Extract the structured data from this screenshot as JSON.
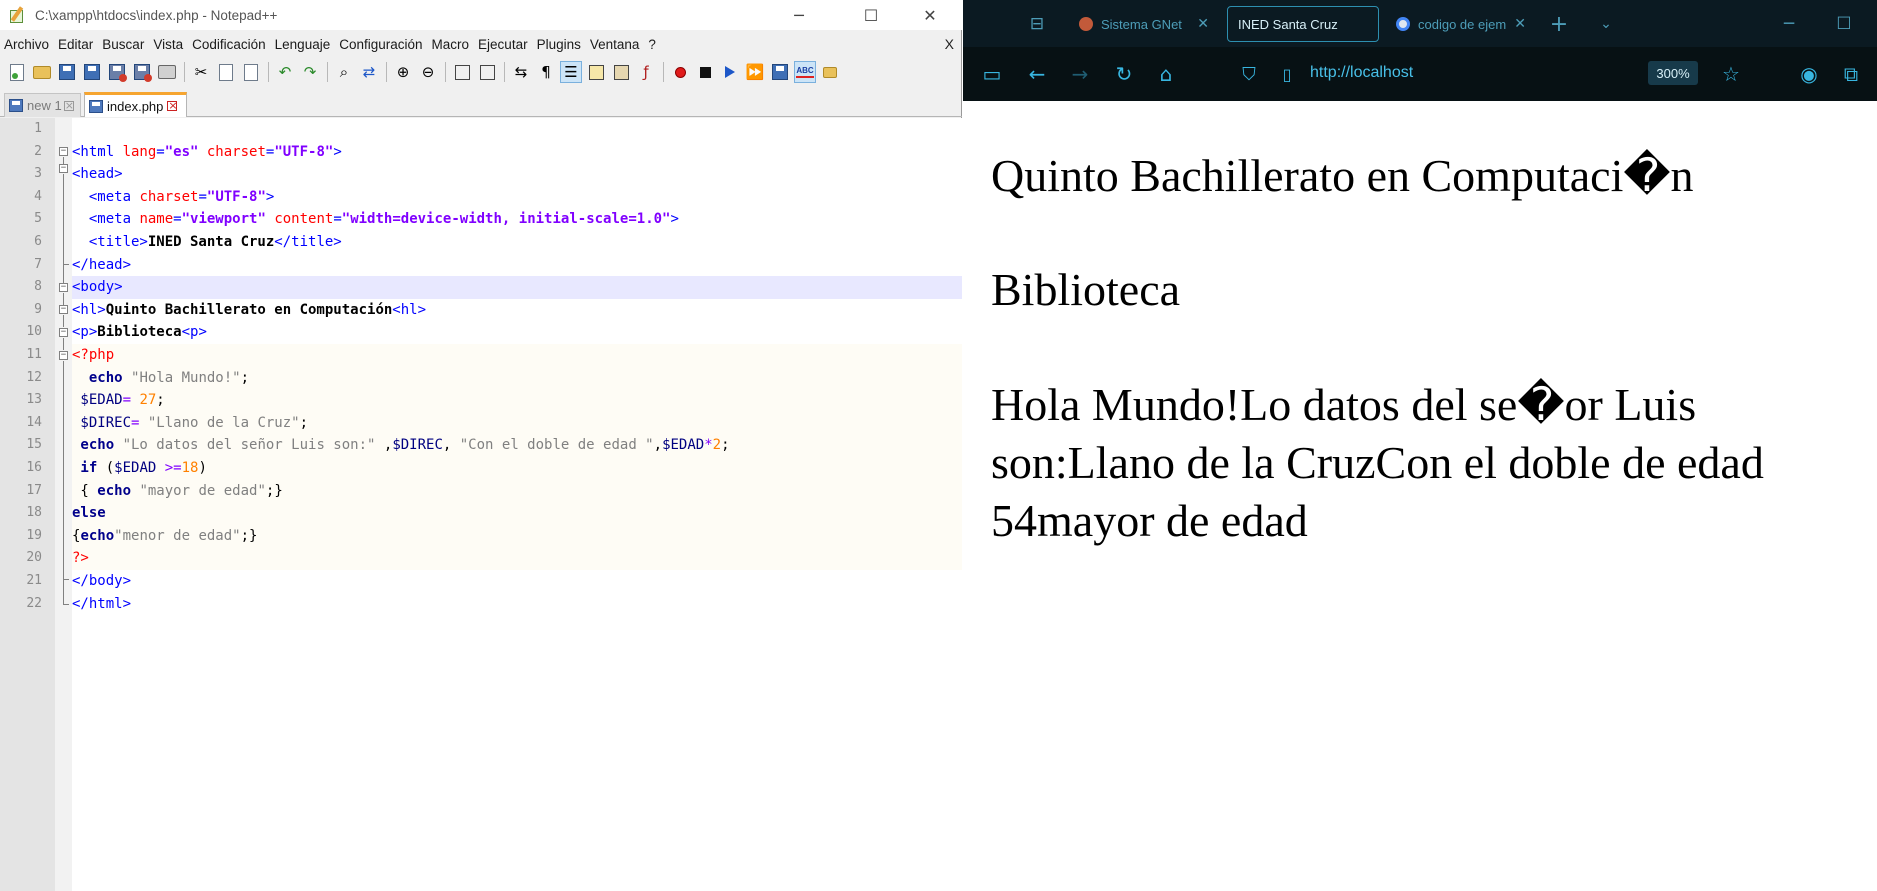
{
  "notepad": {
    "title": "C:\\xampp\\htdocs\\index.php - Notepad++",
    "menu": [
      "Archivo",
      "Editar",
      "Buscar",
      "Vista",
      "Codificación",
      "Lenguaje",
      "Configuración",
      "Macro",
      "Ejecutar",
      "Plugins",
      "Ventana",
      "?"
    ],
    "menu_close": "X",
    "tabs": [
      {
        "label": "new 1"
      },
      {
        "label": "index.php"
      }
    ],
    "line_numbers": [
      "1",
      "2",
      "3",
      "4",
      "5",
      "6",
      "7",
      "8",
      "9",
      "10",
      "11",
      "12",
      "13",
      "14",
      "15",
      "16",
      "17",
      "18",
      "19",
      "20",
      "21",
      "22"
    ],
    "code": {
      "l2": {
        "a": "<html ",
        "b": "lang",
        "c": "=",
        "d": "\"es\"",
        "e": " charset",
        "f": "=",
        "g": "\"UTF-8\"",
        "h": ">"
      },
      "l3": {
        "a": "<head>"
      },
      "l4": {
        "a": "  <meta ",
        "b": "charset",
        "c": "=",
        "d": "\"UTF-8\"",
        "e": ">"
      },
      "l5": {
        "a": "  <meta ",
        "b": "name",
        "c": "=",
        "d": "\"viewport\"",
        "e": " content",
        "f": "=",
        "g": "\"width=device-width, initial-scale=1.0\"",
        "h": ">"
      },
      "l6": {
        "a": "  <title>",
        "b": "INED Santa Cruz",
        "c": "</title>"
      },
      "l7": {
        "a": "</head>"
      },
      "l8": {
        "a": "<body>"
      },
      "l9": {
        "a": "<hl>",
        "b": "Quinto Bachillerato en Computación",
        "c": "<hl>"
      },
      "l10": {
        "a": "<p>",
        "b": "Biblioteca",
        "c": "<p>"
      },
      "l11": {
        "a": "<?php"
      },
      "l12": {
        "a": "  echo ",
        "b": "\"Hola Mundo!\"",
        "c": ";"
      },
      "l13": {
        "a": " $EDAD",
        "b": "= ",
        "c": "27",
        "d": ";"
      },
      "l14": {
        "a": " $DIREC",
        "b": "= ",
        "c": "\"Llano de la Cruz\"",
        "d": ";"
      },
      "l15": {
        "a": " echo ",
        "b": "\"Lo datos del señor Luis son:\"",
        "c": " ,",
        "d": "$DIREC",
        "e": ", ",
        "f": "\"Con el doble de edad \"",
        "g": ",",
        "h": "$EDAD",
        "i": "*",
        "j": "2",
        "k": ";"
      },
      "l16": {
        "a": " if ",
        "b": "(",
        "c": "$EDAD ",
        "d": ">=",
        "e": "18",
        "f": ")"
      },
      "l17": {
        "a": " { ",
        "b": "echo ",
        "c": "\"mayor de edad\"",
        "d": ";}"
      },
      "l18": {
        "a": "else"
      },
      "l19": {
        "a": "{",
        "b": "echo",
        "c": "\"menor de edad\"",
        "d": ";}"
      },
      "l20": {
        "a": "?>"
      },
      "l21": {
        "a": "</body>"
      },
      "l22": {
        "a": "</html>"
      }
    }
  },
  "browser": {
    "tabs": [
      {
        "label": "Sistema GNet"
      },
      {
        "label": "INED Santa Cruz"
      },
      {
        "label": "codigo de ejem"
      }
    ],
    "url": "http://localhost",
    "zoom": "300%",
    "colors": {
      "tab_bar": "#0b1a22",
      "nav_bar": "#071114",
      "accent": "#38b6e0"
    }
  },
  "page": {
    "heading": "Quinto Bachillerato en Computaci�n",
    "paragraph": "Biblioteca",
    "output": "Hola Mundo!Lo datos del se�or Luis son:Llano de la CruzCon el doble de edad 54mayor de edad"
  }
}
